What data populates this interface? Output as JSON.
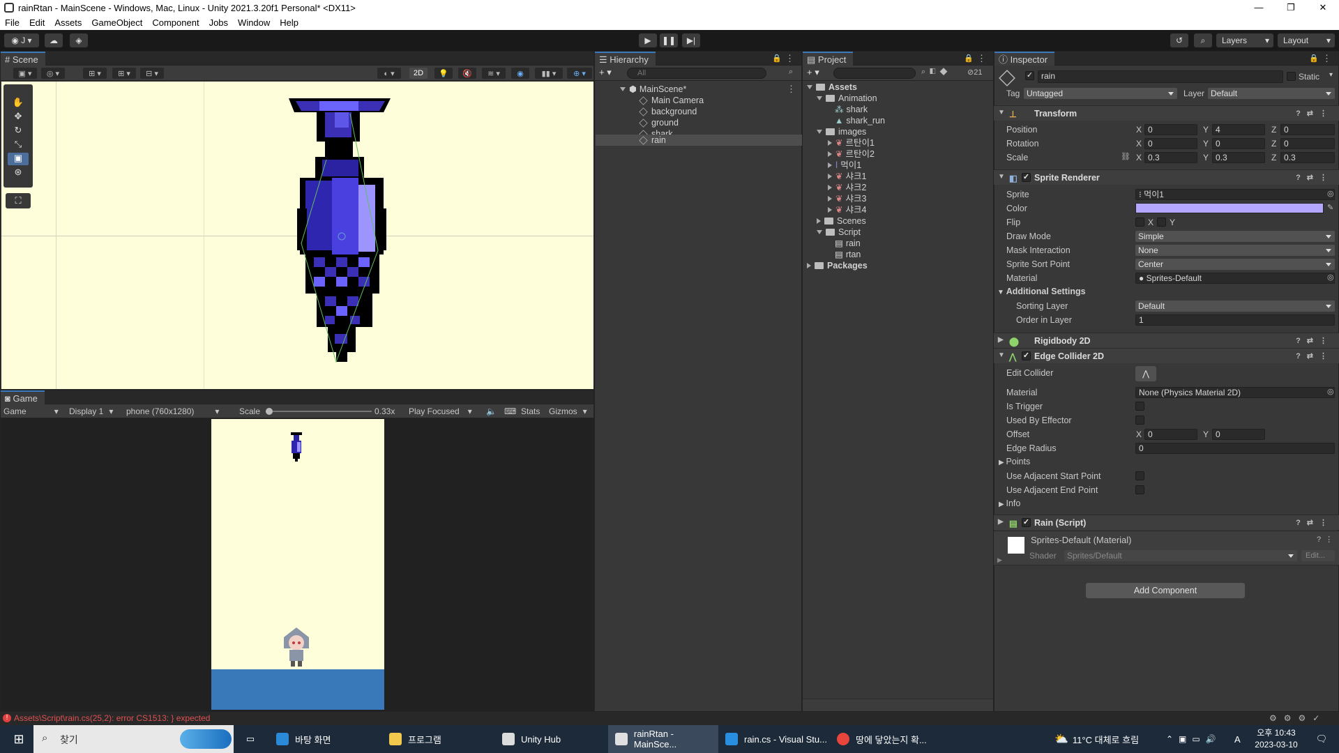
{
  "window": {
    "title": "rainRtan - MainScene - Windows, Mac, Linux - Unity 2021.3.20f1 Personal* <DX11>",
    "minimize": "—",
    "maximize": "❐",
    "close": "✕"
  },
  "menu": [
    "File",
    "Edit",
    "Assets",
    "GameObject",
    "Component",
    "Jobs",
    "Window",
    "Help"
  ],
  "toolbar": {
    "account": "J",
    "layers": "Layers",
    "layout": "Layout"
  },
  "scene": {
    "tab": "Scene",
    "mode_2d": "2D",
    "hidden_count": ""
  },
  "game": {
    "tab": "Game",
    "view": "Game",
    "display": "Display 1",
    "resolution": "phone (760x1280)",
    "scale_label": "Scale",
    "scale_value": "0.33x",
    "play_mode": "Play Focused",
    "stats": "Stats",
    "gizmos": "Gizmos"
  },
  "hierarchy": {
    "tab": "Hierarchy",
    "search_placeholder": "All",
    "scene": "MainScene*",
    "items": [
      "Main Camera",
      "background",
      "ground",
      "shark",
      "rain"
    ]
  },
  "project": {
    "tab": "Project",
    "hidden_count": "21",
    "assets": "Assets",
    "animation": "Animation",
    "anim_items": [
      "shark",
      "shark_run"
    ],
    "images": "images",
    "image_items": [
      "르탄이1",
      "르탄이2",
      "먹이1",
      "샤크1",
      "샤크2",
      "샤크3",
      "샤크4"
    ],
    "scenes": "Scenes",
    "script": "Script",
    "script_items": [
      "rain",
      "rtan"
    ],
    "packages": "Packages"
  },
  "inspector": {
    "tab": "Inspector",
    "object_name": "rain",
    "static": "Static",
    "tag_label": "Tag",
    "tag": "Untagged",
    "layer_label": "Layer",
    "layer": "Default",
    "transform": {
      "title": "Transform",
      "position": [
        "0",
        "4",
        "0"
      ],
      "rotation": [
        "0",
        "0",
        "0"
      ],
      "scale": [
        "0.3",
        "0.3",
        "0.3"
      ],
      "labels": [
        "Position",
        "Rotation",
        "Scale"
      ]
    },
    "sprite_renderer": {
      "title": "Sprite Renderer",
      "sprite_label": "Sprite",
      "sprite": "먹이1",
      "color_label": "Color",
      "color": "#b3a7ff",
      "flip_label": "Flip",
      "draw_mode_label": "Draw Mode",
      "draw_mode": "Simple",
      "mask_label": "Mask Interaction",
      "mask": "None",
      "sort_point_label": "Sprite Sort Point",
      "sort_point": "Center",
      "material_label": "Material",
      "material": "Sprites-Default",
      "additional": "Additional Settings",
      "sorting_layer_label": "Sorting Layer",
      "sorting_layer": "Default",
      "order_label": "Order in Layer",
      "order": "1"
    },
    "rigidbody": {
      "title": "Rigidbody 2D"
    },
    "edge_collider": {
      "title": "Edge Collider 2D",
      "edit_label": "Edit Collider",
      "material_label": "Material",
      "material": "None (Physics Material 2D)",
      "trigger_label": "Is Trigger",
      "effector_label": "Used By Effector",
      "offset_label": "Offset",
      "offset": [
        "0",
        "0"
      ],
      "radius_label": "Edge Radius",
      "radius": "0",
      "points_label": "Points",
      "adj_start_label": "Use Adjacent Start Point",
      "adj_end_label": "Use Adjacent End Point",
      "info_label": "Info"
    },
    "rain_script": {
      "title": "Rain (Script)"
    },
    "material": {
      "name": "Sprites-Default (Material)",
      "shader_label": "Shader",
      "shader": "Sprites/Default",
      "edit": "Edit..."
    },
    "add_component": "Add Component"
  },
  "console_error": "Assets\\Script\\rain.cs(25,2): error CS1513: } expected",
  "taskbar": {
    "search": "찾기",
    "items": [
      "바탕 화면",
      "프로그램",
      "Unity Hub",
      "rainRtan - MainSce...",
      "rain.cs - Visual Stu...",
      "땅에 닿았는지 확..."
    ],
    "weather": "11°C 대체로 흐림",
    "ime": "A",
    "time": "오후 10:43",
    "date": "2023-03-10"
  }
}
